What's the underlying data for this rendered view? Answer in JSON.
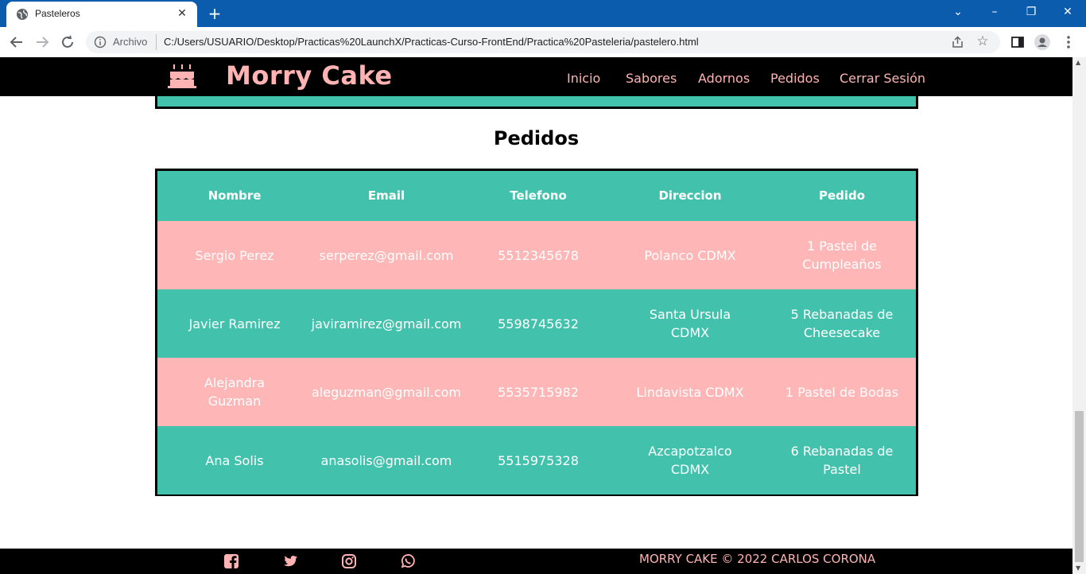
{
  "browser": {
    "tab_title": "Pasteleros",
    "tab_close": "✕",
    "new_tab": "+",
    "scheme_label": "Archivo",
    "url": "C:/Users/USUARIO/Desktop/Practicas%20LaunchX/Practicas-Curso-FrontEnd/Practica%20Pasteleria/pastelero.html",
    "accent": "#0b5cad",
    "window_controls": [
      "⌄",
      "–",
      "❐",
      "✕"
    ]
  },
  "nav": {
    "brand": "Morry Cake",
    "links": [
      "Inicio",
      "Sabores",
      "Adornos",
      "Pedidos",
      "Cerrar Sesión"
    ],
    "brand_color": "#ffb3b3"
  },
  "section": {
    "title": "Pedidos"
  },
  "table": {
    "headers": [
      "Nombre",
      "Email",
      "Telefono",
      "Direccion",
      "Pedido"
    ],
    "rows": [
      {
        "nombre": "Sergio Perez",
        "email": "serperez@gmail.com",
        "telefono": "5512345678",
        "direccion": "Polanco CDMX",
        "pedido": [
          "1 Pastel de",
          "Cumpleaños"
        ],
        "color": "#ffb6b6"
      },
      {
        "nombre": "Javier Ramirez",
        "email": "javiramirez@gmail.com",
        "telefono": "5598745632",
        "direccion": [
          "Santa Ursula",
          "CDMX"
        ],
        "pedido": [
          "5 Rebanadas de",
          "Cheesecake"
        ],
        "color": "#42c2ad"
      },
      {
        "nombre": [
          "Alejandra",
          "Guzman"
        ],
        "email": "aleguzman@gmail.com",
        "telefono": "5535715982",
        "direccion": "Lindavista CDMX",
        "pedido": "1 Pastel de Bodas",
        "color": "#ffb6b6"
      },
      {
        "nombre": "Ana Solis",
        "email": "anasolis@gmail.com",
        "telefono": "5515975328",
        "direccion": [
          "Azcapotzalco",
          "CDMX"
        ],
        "pedido": [
          "6 Rebanadas de",
          "Pastel"
        ],
        "color": "#42c2ad"
      }
    ],
    "header_color": "#42c2ad"
  },
  "footer": {
    "social_icons": [
      "facebook-icon",
      "twitter-icon",
      "instagram-icon",
      "whatsapp-icon"
    ],
    "copyright": "MORRY CAKE © 2022 CARLOS CORONA"
  }
}
